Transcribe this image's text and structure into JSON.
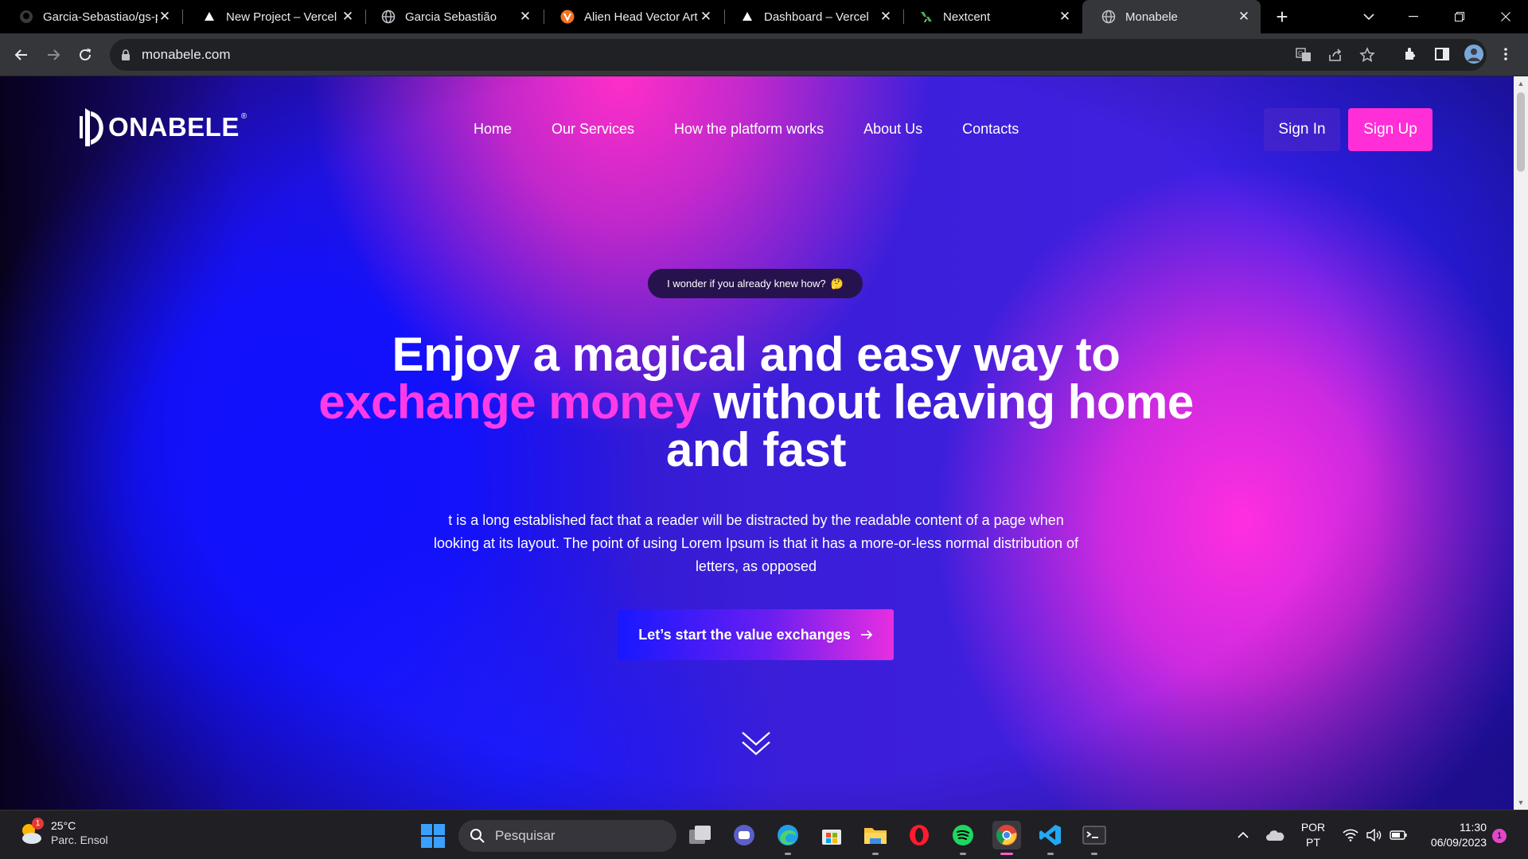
{
  "browser": {
    "tabs": [
      {
        "title": "Garcia-Sebastiao/gs-p",
        "icon": "github-icon"
      },
      {
        "title": "New Project – Vercel",
        "icon": "vercel-icon"
      },
      {
        "title": "Garcia Sebastião",
        "icon": "globe-icon"
      },
      {
        "title": "Alien Head Vector Art",
        "icon": "vecteezy-icon"
      },
      {
        "title": "Dashboard – Vercel",
        "icon": "vercel-icon"
      },
      {
        "title": "Nextcent",
        "icon": "nextcent-icon"
      },
      {
        "title": "Monabele",
        "icon": "globe-icon",
        "active": true
      }
    ],
    "url": "monabele.com"
  },
  "site": {
    "logo_text": "ONABELE",
    "logo_reg": "®",
    "nav": [
      "Home",
      "Our Services",
      "How the platform works",
      "About Us",
      "Contacts"
    ],
    "signin_label": "Sign In",
    "signup_label": "Sign Up",
    "pill_text": "I wonder if you already knew how?",
    "pill_emoji": "🤔",
    "headline_part1": "Enjoy a magical and easy way to",
    "headline_highlight": "exchange money",
    "headline_part2": "without leaving home and fast",
    "description": "t is a long established fact that a reader will be distracted by the readable content of a page when looking at its layout. The point of using Lorem Ipsum is that it has a more-or-less normal distribution of letters, as opposed",
    "cta_label": "Let’s start the value exchanges",
    "colors": {
      "accent_pink": "#ff2ed6",
      "accent_blue": "#1818ff",
      "pill_bg": "#26134d"
    }
  },
  "taskbar": {
    "weather_temp": "25°C",
    "weather_desc": "Parc. Ensol",
    "weather_badge": "1",
    "search_placeholder": "Pesquisar",
    "lang_line1": "POR",
    "lang_line2": "PT",
    "time": "11:30",
    "date": "06/09/2023",
    "notif_count": "1"
  }
}
